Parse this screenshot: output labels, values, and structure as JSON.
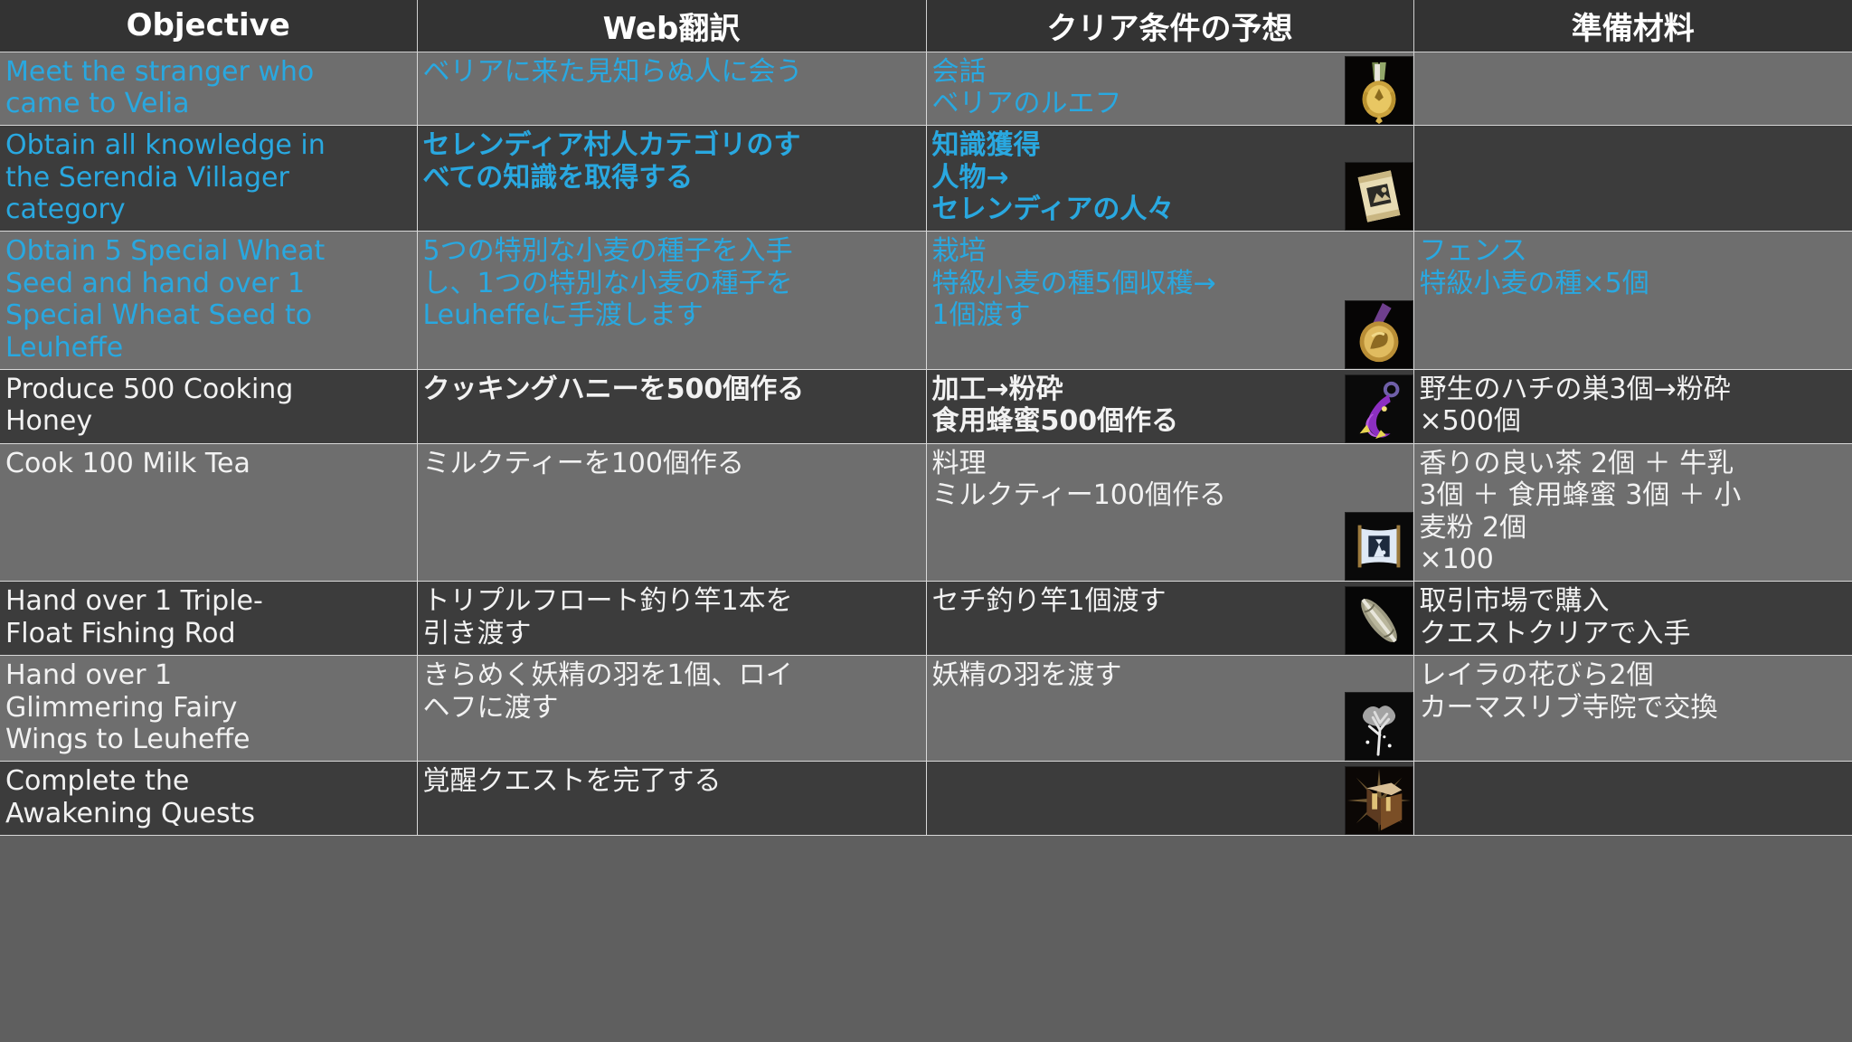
{
  "table": {
    "headers": [
      {
        "label": "Objective",
        "name": "column-header-objective"
      },
      {
        "label": "Web翻訳",
        "name": "column-header-web-translation"
      },
      {
        "label": "クリア条件の予想",
        "name": "column-header-clear-condition"
      },
      {
        "label": "準備材料",
        "name": "column-header-materials"
      }
    ],
    "rows": [
      {
        "band": "light",
        "tone": "cyan",
        "objective": [
          "Meet the stranger who",
          "came to Velia"
        ],
        "translation": [
          "ベリアに来た見知らぬ人に会う"
        ],
        "condition": [
          "会話",
          "ベリアのルエフ"
        ],
        "materials": [],
        "icon": "medal-laurel-gold-icon",
        "bold": false
      },
      {
        "band": "dark",
        "tone": "cyan",
        "objective": [
          "Obtain all knowledge in",
          "the Serendia Villager",
          "category"
        ],
        "translation": [
          "セレンディア村人カテゴリのす",
          "べての知識を取得する"
        ],
        "condition": [
          "知識獲得",
          "人物→",
          "セレンディアの人々"
        ],
        "materials": [],
        "icon": "knowledge-scroll-icon",
        "bold": true
      },
      {
        "band": "light",
        "tone": "cyan",
        "objective": [
          "Obtain 5 Special Wheat",
          "Seed and hand over 1",
          "Special Wheat Seed to",
          "Leuheffe"
        ],
        "translation": [
          "5つの特別な小麦の種子を入手",
          "し、1つの特別な小麦の種子を",
          "Leuheffeに手渡します"
        ],
        "condition": [
          "栽培",
          "特級小麦の種5個収穫→",
          "1個渡す"
        ],
        "materials": [
          "フェンス",
          "特級小麦の種×5個"
        ],
        "icon": "medal-bronze-farming-icon",
        "bold": false
      },
      {
        "band": "dark",
        "tone": "white",
        "objective": [
          "Produce 500 Cooking",
          "Honey"
        ],
        "translation": [
          "クッキングハニーを500個作る"
        ],
        "condition": [
          "加工→粉砕",
          "食用蜂蜜500個作る"
        ],
        "materials": [
          "野生のハチの巣3個→粉砕",
          "×500個"
        ],
        "icon": "purple-horn-amulet-icon",
        "bold": true
      },
      {
        "band": "light",
        "tone": "white",
        "objective": [
          "Cook 100 Milk Tea"
        ],
        "translation": [
          "ミルクティーを100個作る"
        ],
        "condition": [
          "料理",
          "ミルクティー100個作る"
        ],
        "materials": [
          "香りの良い茶 2個 ＋ 牛乳",
          "3個 ＋ 食用蜂蜜 3個 ＋ 小",
          "麦粉 2個",
          "×100"
        ],
        "icon": "cooking-scroll-blue-icon",
        "bold": false
      },
      {
        "band": "dark",
        "tone": "white",
        "objective": [
          "Hand over 1 Triple-",
          "Float Fishing Rod"
        ],
        "translation": [
          "トリプルフロート釣り竿1本を",
          "引き渡す"
        ],
        "condition": [
          "セチ釣り竿1個渡す"
        ],
        "materials": [
          "取引市場で購入",
          "クエストクリアで入手"
        ],
        "icon": "fishing-rod-icon",
        "bold": false
      },
      {
        "band": "light",
        "tone": "white",
        "objective": [
          "Hand over 1",
          "Glimmering Fairy",
          "Wings to Leuheffe"
        ],
        "translation": [
          "きらめく妖精の羽を1個、ロイ",
          "ヘフに渡す"
        ],
        "condition": [
          "妖精の羽を渡す"
        ],
        "materials": [
          "レイラの花びら2個",
          "カーマスリブ寺院で交換"
        ],
        "icon": "glowing-tree-icon",
        "bold": false
      },
      {
        "band": "dark",
        "tone": "white",
        "objective": [
          "Complete the",
          "Awakening Quests"
        ],
        "translation": [
          "覚醒クエストを完了する"
        ],
        "condition": [],
        "materials": [],
        "icon": "treasure-chest-icon",
        "bold": false
      }
    ]
  },
  "colors": {
    "cyan_text": "#29a8e0",
    "white_text": "#f2f2f2",
    "band_light": "#6e6e6e",
    "band_dark": "#3c3c3c",
    "header_bg": "#333333",
    "grid_line": "#d8d8d8",
    "page_bg": "#5f5f5f"
  }
}
